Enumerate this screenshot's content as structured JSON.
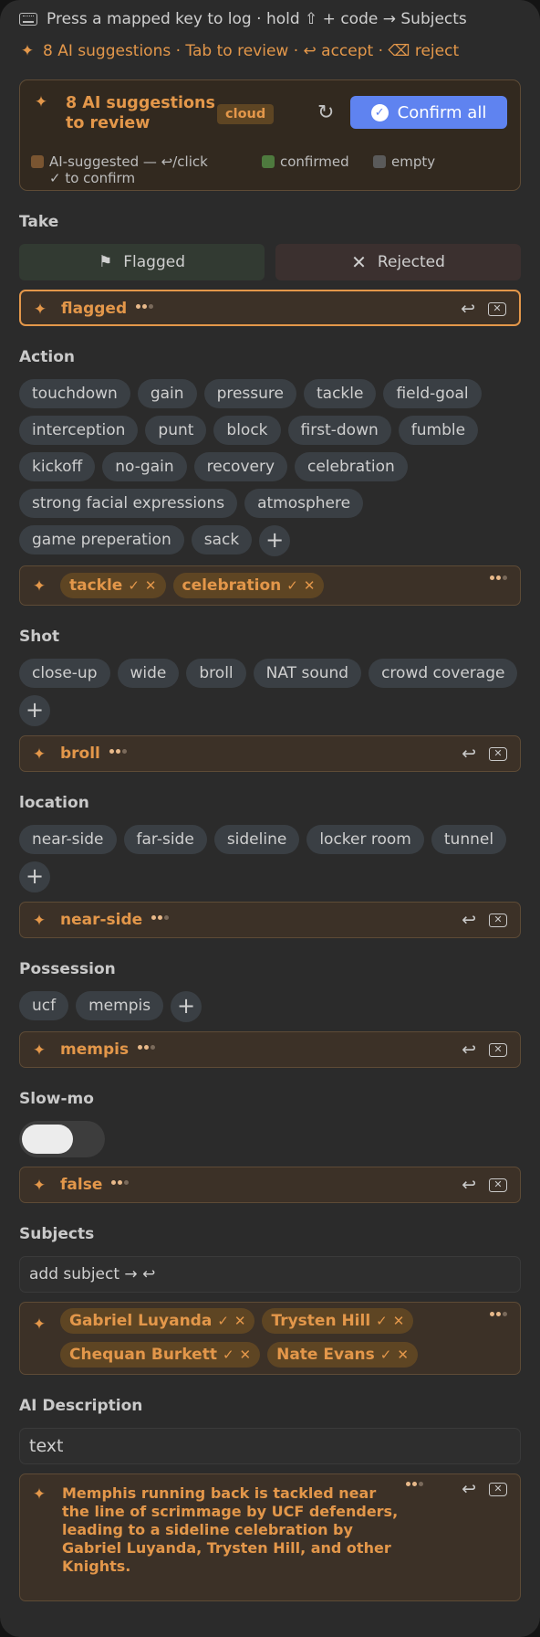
{
  "hints": {
    "line1": "Press a mapped key to log · hold ⇧ + code → Subjects",
    "line2": "8 AI suggestions · Tab to review · ↩ accept · ⌫ reject"
  },
  "review": {
    "title": "8 AI suggestions to review",
    "badge": "cloud",
    "confirm_label": "Confirm all",
    "legend": [
      {
        "label": "AI-suggested — ↩/click ✓ to confirm",
        "color": "#7a5531"
      },
      {
        "label": "confirmed",
        "color": "#4e7a3e"
      },
      {
        "label": "empty",
        "color": "#5a5a5a"
      }
    ]
  },
  "take": {
    "label": "Take",
    "flagged_label": "Flagged",
    "rejected_label": "Rejected",
    "ai_value": "flagged"
  },
  "action": {
    "label": "Action",
    "chips": [
      "touchdown",
      "gain",
      "pressure",
      "tackle",
      "field-goal",
      "interception",
      "punt",
      "block",
      "first-down",
      "fumble",
      "kickoff",
      "no-gain",
      "recovery",
      "celebration",
      "strong facial expressions",
      "atmosphere",
      "game preperation",
      "sack"
    ],
    "ai_values": [
      "tackle",
      "celebration"
    ]
  },
  "shot": {
    "label": "Shot",
    "chips": [
      "close-up",
      "wide",
      "broll",
      "NAT sound",
      "crowd coverage"
    ],
    "ai_value": "broll"
  },
  "location": {
    "label": "location",
    "chips": [
      "near-side",
      "far-side",
      "sideline",
      "locker room",
      "tunnel"
    ],
    "ai_value": "near-side"
  },
  "possession": {
    "label": "Possession",
    "chips": [
      "ucf",
      "mempis"
    ],
    "ai_value": "mempis"
  },
  "slowmo": {
    "label": "Slow-mo",
    "toggle_on": false,
    "ai_value": "false"
  },
  "subjects": {
    "label": "Subjects",
    "placeholder": "add subject → ↩",
    "ai_values": [
      "Gabriel Luyanda",
      "Trysten Hill",
      "Chequan Burkett",
      "Nate Evans"
    ]
  },
  "ai_description": {
    "label": "AI Description",
    "input_value": "text",
    "ai_value": "Memphis running back is tackled near the line of scrimmage by UCF defenders, leading to a sideline celebration by Gabriel Luyanda, Trysten Hill, and other Knights."
  },
  "colors": {
    "accent_orange": "#e3974a",
    "primary_blue": "#5f83f0",
    "panel_bg": "#2b2b2b"
  }
}
